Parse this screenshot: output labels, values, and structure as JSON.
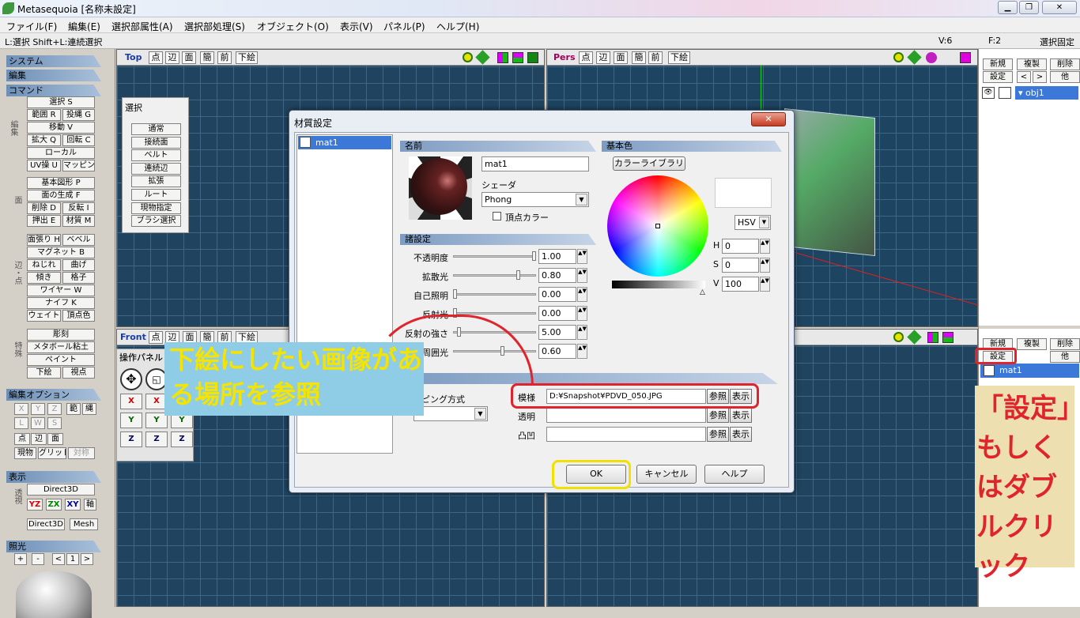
{
  "window": {
    "title": "Metasequoia [名称未設定]",
    "min": "▁",
    "max": "❐",
    "close": "✕"
  },
  "menu": [
    "ファイル(F)",
    "編集(E)",
    "選択部属性(A)",
    "選択部処理(S)",
    "オブジェクト(O)",
    "表示(V)",
    "パネル(P)",
    "ヘルプ(H)"
  ],
  "status": {
    "hint": "L:選択  Shift+L:連続選択",
    "vertices": "V:6",
    "faces": "F:2",
    "lock": "選択固定"
  },
  "left_panel": {
    "system": "システム",
    "edit": "編集",
    "command": "コマンド",
    "edit_group": "編集",
    "cmds1": [
      "選択 S",
      "範囲 R",
      "投縄 G",
      "移動 V",
      "拡大 Q",
      "回転 C",
      "ローカル",
      "UV操 U",
      "マッピング"
    ],
    "face_group": "面",
    "cmds2": [
      "基本図形 P",
      "面の生成 F",
      "削除 D",
      "反転 I",
      "押出 E",
      "材質 M"
    ],
    "edge_group": "辺・点",
    "cmds3": [
      "面張り H",
      "ベベル",
      "マグネット B",
      "ねじれ",
      "曲げ",
      "傾き",
      "格子",
      "ワイヤー W",
      "ナイフ K",
      "ウェイト",
      "頂点色"
    ],
    "special_group": "特殊",
    "cmds4": [
      "彫刻",
      "メタボール粘土",
      "ペイント",
      "下絵",
      "視点"
    ],
    "edit_options": "編集オプション",
    "opt_axes": [
      "X",
      "Y",
      "Z",
      "範",
      "縄"
    ],
    "opt_lws": [
      "L",
      "W",
      "S"
    ],
    "opt_mode": [
      "点",
      "辺",
      "面"
    ],
    "opt_misc": [
      "現物",
      "グリッド",
      "対称"
    ],
    "display": "表示",
    "display_items": [
      "Direct3D",
      "YZ",
      "ZX",
      "XY",
      "軸",
      "Direct3D",
      "Mesh"
    ],
    "display_side": "透視",
    "light": "照光",
    "light_ctrls": [
      "+",
      "-",
      "<",
      "1",
      ">"
    ]
  },
  "select_panel": {
    "title": "選択",
    "items": [
      "通常",
      "接続面",
      "ベルト",
      "連続辺",
      "拡張",
      "ルート",
      "現物指定",
      "ブラシ選択"
    ]
  },
  "viewports": {
    "top": {
      "name": "Top",
      "buttons": [
        "点",
        "辺",
        "面",
        "簡",
        "前",
        "下絵"
      ]
    },
    "pers": {
      "name": "Pers",
      "buttons": [
        "点",
        "辺",
        "面",
        "簡",
        "前",
        "下絵"
      ]
    },
    "front": {
      "name": "Front",
      "buttons": [
        "点",
        "辺",
        "面",
        "簡",
        "前",
        "下絵"
      ]
    }
  },
  "op_panel": {
    "title": "操作パネル",
    "rows": [
      [
        "X",
        "X"
      ],
      [
        "Y",
        "Y",
        "Y"
      ],
      [
        "Z",
        "Z",
        "Z"
      ]
    ]
  },
  "right_panel": {
    "obj_buttons": [
      "新規",
      "複製",
      "削除",
      "設定",
      "<",
      ">",
      "他"
    ],
    "object": "obj1",
    "mat_buttons": [
      "新規",
      "複製",
      "削除",
      "設定",
      "他"
    ],
    "material": "mat1"
  },
  "dialog": {
    "title": "材質設定",
    "mat_list": [
      "mat1"
    ],
    "name_section": "名前",
    "name_value": "mat1",
    "shader_label": "シェーダ",
    "shader_value": "Phong",
    "vertex_color": "頂点カラー",
    "base_color": "基本色",
    "color_library": "カラーライブラリ",
    "color_mode": "HSV",
    "hsv": [
      {
        "l": "H",
        "v": "0"
      },
      {
        "l": "S",
        "v": "0"
      },
      {
        "l": "V",
        "v": "100"
      }
    ],
    "settings_section": "諸設定",
    "params": [
      {
        "label": "不透明度",
        "value": "1.00",
        "pos": 1.0
      },
      {
        "label": "拡散光",
        "value": "0.80",
        "pos": 0.8
      },
      {
        "label": "自己照明",
        "value": "0.00",
        "pos": 0.0
      },
      {
        "label": "反射光",
        "value": "0.00",
        "pos": 0.0
      },
      {
        "label": "反射の強さ",
        "value": "5.00",
        "pos": 0.05
      },
      {
        "label": "周囲光",
        "value": "0.60",
        "pos": 0.6
      }
    ],
    "mapping_section": "ング",
    "mapping_method": "ピング方式",
    "maps": [
      {
        "label": "模様",
        "value": "D:¥Snapshot¥PDVD_050.JPG",
        "ref": "参照",
        "show": "表示"
      },
      {
        "label": "透明",
        "value": "",
        "ref": "参照",
        "show": "表示"
      },
      {
        "label": "凸凹",
        "value": "",
        "ref": "参照",
        "show": "表示"
      }
    ],
    "ok": "OK",
    "cancel": "キャンセル",
    "help": "ヘルプ"
  },
  "annotations": {
    "callout": "下絵にしたい画像がある場所を参照",
    "side_note": "「設定」もしくはダブルクリック"
  },
  "colors": {
    "accent": "#3b78d8",
    "grid": "#20445f",
    "highlight_red": "#e0242c",
    "highlight_yellow": "#f2e000",
    "callout_bg": "#8fcde6",
    "note_bg": "#eedfb0"
  }
}
